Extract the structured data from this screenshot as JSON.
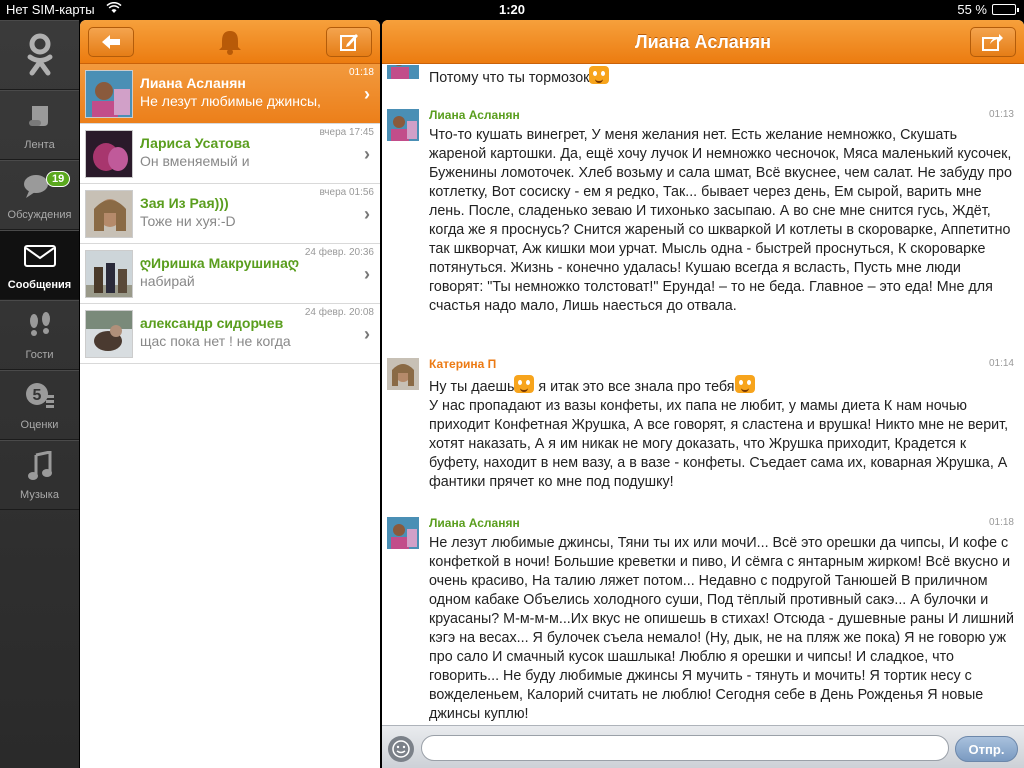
{
  "status_bar": {
    "carrier": "Нет SIM-карты",
    "time": "1:20",
    "battery": "55 %",
    "battery_level": 0.55
  },
  "nav": {
    "items": [
      {
        "label": "Лента",
        "icon": "feed-icon"
      },
      {
        "label": "Обсуждения",
        "icon": "discussions-icon",
        "badge": "19"
      },
      {
        "label": "Сообщения",
        "icon": "messages-icon",
        "active": true
      },
      {
        "label": "Гости",
        "icon": "footprints-icon"
      },
      {
        "label": "Оценки",
        "icon": "ratings-icon"
      },
      {
        "label": "Музыка",
        "icon": "music-icon"
      }
    ]
  },
  "list": {
    "conversations": [
      {
        "name": "Лиана Асланян",
        "preview": "Не лезут любимые джинсы,",
        "time": "01:18",
        "active": true
      },
      {
        "name": "Лариса Усатова",
        "preview": "Он вменяемый и",
        "time": "вчера 17:45"
      },
      {
        "name": "Зая Из Рая)))",
        "preview": "Тоже ни хуя:-D",
        "time": "вчера 01:56"
      },
      {
        "name": "ღИришка Макрушинаღ",
        "preview": "набирай",
        "time": "24 февр. 20:36"
      },
      {
        "name": "александр сидорчев",
        "preview": "щас пока нет ! не когда",
        "time": "24 февр. 20:08"
      }
    ]
  },
  "chat": {
    "title": "Лиана Асланян",
    "partial_message": "Потому что ты тормозок",
    "messages": [
      {
        "author": "Лиана Асланян",
        "time": "01:13",
        "text": "Что-то кушать винегрет, У меня желания нет. Есть желание немножко, Скушать жареной картошки. Да, ещё хочу лучок И немножко чесночок, Мяса маленький кусочек, Буженины ломоточек. Хлеб возьму и сала шмат, Всё вкуснее, чем салат. Не забуду про котлетку, Вот сосиску - ем я редко, Так... бывает через день, Ем сырой, варить мне лень. После, сладенько зеваю И тихонько засыпаю. А во сне мне снится гусь, Ждёт, когда же я проснусь? Снится жареный со шкваркой И котлеты в скороварке, Аппетитно так шкворчат, Аж кишки мои урчат. Мысль одна - быстрей проснуться, К скороварке потянуться. Жизнь - конечно удалась! Кушаю всегда я всласть, Пусть мне люди говорят: \"Ты немножко толстоват!\" Ерунда! – то не беда. Главное – это еда! Мне для счастья надо мало, Лишь наесться до отвала."
      },
      {
        "author": "Катерина П",
        "time": "01:14",
        "text_a": "Ну ты даешь",
        "text_b": "я итак это все знала про тебя",
        "text_c": "У нас пропадают из вазы конфеты, их папа не любит, у мамы диета К нам ночью приходит Конфетная Жрушка, А все говорят, я сластена и врушка! Никто мне не верит, хотят наказать, А я им никак не могу доказать, что Жрушка приходит, Крадется к буфету, находит в нем вазу, а в вазе - конфеты. Съедает сама их, коварная Жрушка, А фантики прячет ко мне под подушку!"
      },
      {
        "author": "Лиана Асланян",
        "time": "01:18",
        "text": "Не лезут любимые джинсы, Тяни ты их или мочИ... Всё это орешки да чипсы, И кофе с конфеткой в ночи! Большие креветки и пиво, И сёмга с янтарным жирком! Всё вкусно и очень красиво, На талию ляжет потом... Недавно с подругой Танюшей В приличном одном кабаке Объелись холодного суши, Под тёплый противный сакэ... А булочки и круасаны? М-м-м-м...Их вкус не опишешь в стихах! Отсюда - душевные раны И лишний кэгэ на весах... Я булочек съела немало! (Ну, дык, не на пляж же пока) Я не говорю уж про сало И смачный кусок шашлыка! Люблю я орешки и чипсы! И сладкое, что говорить... Не буду любимые джинсы Я мучить - тянуть и мочить! Я тортик несу с вожделеньем, Калорий считать не люблю! Сегодня себе в День Рожденья Я новые джинсы куплю!"
      }
    ]
  },
  "compose": {
    "placeholder": "",
    "send_label": "Отпр."
  },
  "colors": {
    "accent": "#ec7c10",
    "name_green": "#5a9e1e"
  }
}
